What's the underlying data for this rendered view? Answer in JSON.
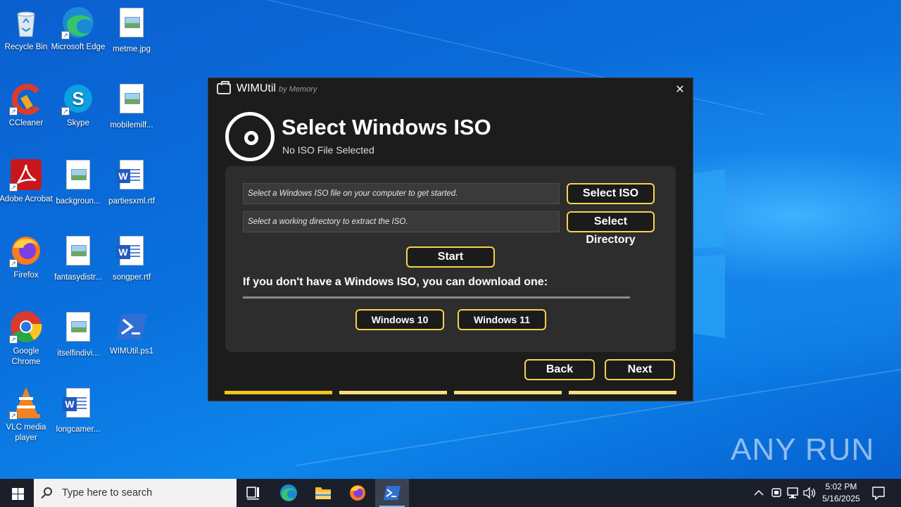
{
  "desktop": {
    "icons": [
      {
        "label": "Recycle Bin"
      },
      {
        "label": "Microsoft Edge"
      },
      {
        "label": "metme.jpg"
      },
      {
        "label": "CCleaner"
      },
      {
        "label": "Skype"
      },
      {
        "label": "mobilemilf..."
      },
      {
        "label": "Adobe Acrobat"
      },
      {
        "label": "backgroun..."
      },
      {
        "label": "partiesxml.rtf"
      },
      {
        "label": "Firefox"
      },
      {
        "label": "fantasydistr..."
      },
      {
        "label": "songper.rtf"
      },
      {
        "label": "Google Chrome"
      },
      {
        "label": "itselfindivi..."
      },
      {
        "label": "WIMUtil.ps1"
      },
      {
        "label": "VLC media player"
      },
      {
        "label": "longcamer..."
      }
    ],
    "watermark": "ANY RUN"
  },
  "window": {
    "title": "WIMUtil",
    "subtitle": "by Memory",
    "close_glyph": "✕",
    "heading": "Select Windows ISO",
    "status": "No ISO File Selected",
    "iso_field_placeholder": "Select a Windows ISO file on your computer to get started.",
    "dir_field_placeholder": "Select a working directory to extract the ISO.",
    "select_iso_label": "Select ISO",
    "select_dir_label": "Select Directory",
    "start_label": "Start",
    "download_label": "If you don't have a Windows ISO, you can download one:",
    "win10_label": "Windows 10",
    "win11_label": "Windows 11",
    "back_label": "Back",
    "next_label": "Next",
    "steps_total": 4,
    "current_step": 1,
    "accent_color": "#f5c518"
  },
  "taskbar": {
    "search_placeholder": "Type here to search",
    "time": "5:02 PM",
    "date": "5/16/2025",
    "pinned": [
      "task-view-icon",
      "edge-icon",
      "file-explorer-icon",
      "firefox-icon",
      "powershell-icon"
    ]
  }
}
